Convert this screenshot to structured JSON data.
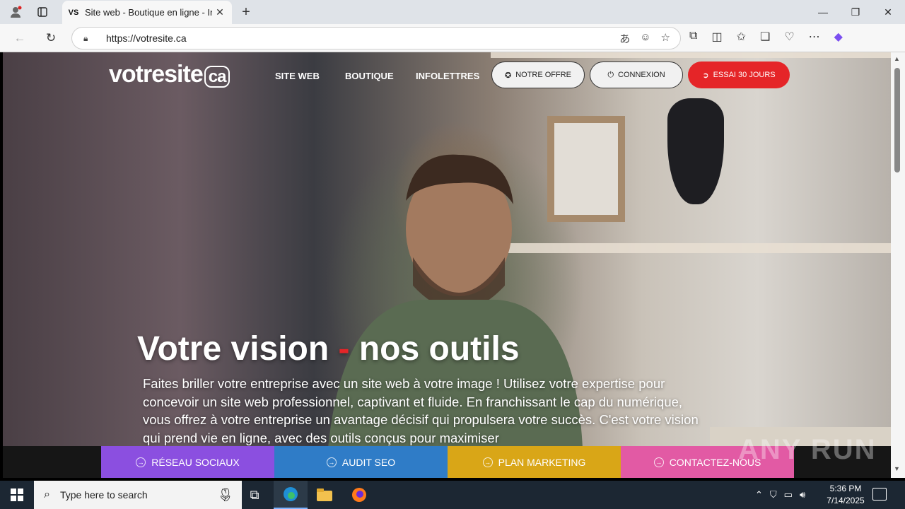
{
  "browser": {
    "tab_title": "Site web - Boutique en ligne - Info",
    "tab_favicon": "VS",
    "url": "https://votresite.ca"
  },
  "site": {
    "logo_text": "votresite",
    "logo_suffix": "ca",
    "menu": [
      "SITE WEB",
      "BOUTIQUE",
      "INFOLETTRES"
    ],
    "btn_offer": "NOTRE OFFRE",
    "btn_login": "CONNEXION",
    "btn_trial": "ESSAI 30 JOURS",
    "hero_title_a": "Votre vision",
    "hero_title_dash": "-",
    "hero_title_b": "nos outils",
    "hero_text": "Faites briller votre entreprise avec un site web à votre image ! Utilisez votre expertise pour concevoir un site web professionnel, captivant et fluide. En franchissant le cap du numérique, vous offrez à votre entreprise un avantage décisif qui propulsera votre succès. C'est votre vision qui prend vie en ligne, avec des outils conçus pour maximiser",
    "bottom_links": [
      {
        "label": "RÉSEAU SOCIAUX",
        "color": "#8b4fe0"
      },
      {
        "label": "AUDIT SEO",
        "color": "#2f7cc7"
      },
      {
        "label": "PLAN MARKETING",
        "color": "#d9a617"
      },
      {
        "label": "CONTACTEZ-NOUS",
        "color": "#e25aa4"
      }
    ],
    "accent_red": "#e52528"
  },
  "watermark": "ANY RUN",
  "taskbar": {
    "search_placeholder": "Type here to search",
    "time": "5:36 PM",
    "date": "7/14/2025"
  }
}
